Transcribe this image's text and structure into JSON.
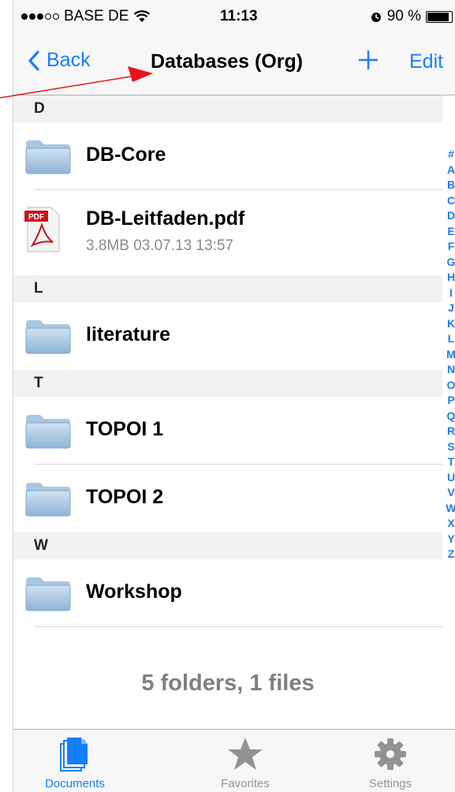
{
  "status_bar": {
    "carrier": "BASE DE",
    "time": "11:13",
    "battery": "90 %",
    "battery_level": 0.9
  },
  "nav": {
    "back_label": "Back",
    "title": "Databases (Org)",
    "edit_label": "Edit"
  },
  "sections": [
    {
      "letter": "D"
    },
    {
      "letter": "L"
    },
    {
      "letter": "T"
    },
    {
      "letter": "W"
    }
  ],
  "items": [
    {
      "name": "DB-Core",
      "icon": "folder-icon"
    },
    {
      "name": "DB-Leitfaden.pdf",
      "meta": "3.8MB 03.07.13 13:57",
      "icon": "pdf-icon"
    },
    {
      "name": "literature",
      "icon": "folder-icon"
    },
    {
      "name": "TOPOI 1",
      "icon": "folder-icon"
    },
    {
      "name": "TOPOI 2",
      "icon": "folder-icon"
    },
    {
      "name": "Workshop",
      "icon": "folder-icon"
    }
  ],
  "summary": "5 folders, 1 files",
  "index_letters": [
    "#",
    "A",
    "B",
    "C",
    "D",
    "E",
    "F",
    "G",
    "H",
    "I",
    "J",
    "K",
    "L",
    "M",
    "N",
    "O",
    "P",
    "Q",
    "R",
    "S",
    "T",
    "U",
    "V",
    "W",
    "X",
    "Y",
    "Z"
  ],
  "tabs": [
    {
      "label": "Documents",
      "icon": "documents-icon",
      "selected": true
    },
    {
      "label": "Favorites",
      "icon": "star-icon",
      "selected": false
    },
    {
      "label": "Settings",
      "icon": "gear-icon",
      "selected": false
    }
  ],
  "colors": {
    "accent": "#157efb",
    "annotation_arrow": "#e8141a",
    "inactive_tab": "#929292"
  }
}
